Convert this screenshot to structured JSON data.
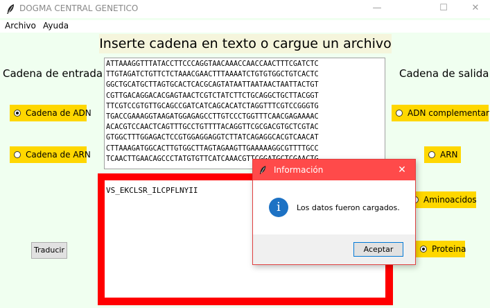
{
  "window": {
    "title": "DOGMA CENTRAL GENETICO",
    "minimize": "—",
    "maximize": "☐",
    "close": "✕"
  },
  "menu": [
    "Archivo",
    "Ayuda"
  ],
  "heading": "Inserte cadena en texto o cargue un archivo",
  "input_section": {
    "label": "Cadena de entrada",
    "options": [
      {
        "label": "Cadena de ADN",
        "selected": true
      },
      {
        "label": "Cadena de ARN",
        "selected": false
      }
    ]
  },
  "output_section": {
    "label": "Cadena de salida",
    "options": [
      {
        "label": "ADN complementario",
        "selected": false
      },
      {
        "label": "ARN",
        "selected": false
      },
      {
        "label": "Aminoacidos",
        "selected": false
      },
      {
        "label": "Proteina",
        "selected": true
      }
    ]
  },
  "input_text": "ATTAAAGGTTTATACCTTCCCAGGTAACAAACCAACCAACTTTCGATCTC\nTTGTAGATCTGTTCTCTAAACGAACTTTAAAATCTGTGTGGCTGTCACTC\nGGCTGCATGCTTAGTGCACTCACGCAGTATAATTAATAACTAATTACTGT\nCGTTGACAGGACACGAGTAACTCGTCTATCTTCTGCAGGCTGCTTACGGT\nTTCGTCCGTGTTGCAGCCGATCATCAGCACATCTAGGTTTCGTCCGGGTG\nTGACCGAAAGGTAAGATGGAGAGCCTTGTCCCTGGTTTCAACGAGAAAAC\nACACGTCCAACTCAGTTTGCCTGTTTTACAGGTTCGCGACGTGCTCGTAC\nGTGGCTTTGGAGACTCCGTGGAGGAGGTCTTATCAGAGGCACGTCAACAT\nCTTAAAGATGGCACTTGTGGCTTAGTAGAAGTTGAAAAAGGCGTTTTGCC\nTCAACTTGAACAGCCCTATGTGTTCATCAAACGTTCGGATGCTCGAACTG",
  "output_text": "VS_EKCLSR_ILCPFLNYII",
  "translate_button": "Traducir",
  "dialog": {
    "title": "Información",
    "message": "Los datos fueron cargados.",
    "ok": "Aceptar",
    "icon_letter": "i"
  },
  "colors": {
    "background": "#f0fff0",
    "radio_bg": "#ffd700",
    "output_border": "#ff0000",
    "heading_bg": "#f5f5dc",
    "dialog_title_bg": "#ff4a4a",
    "info_icon": "#1d72c4"
  }
}
